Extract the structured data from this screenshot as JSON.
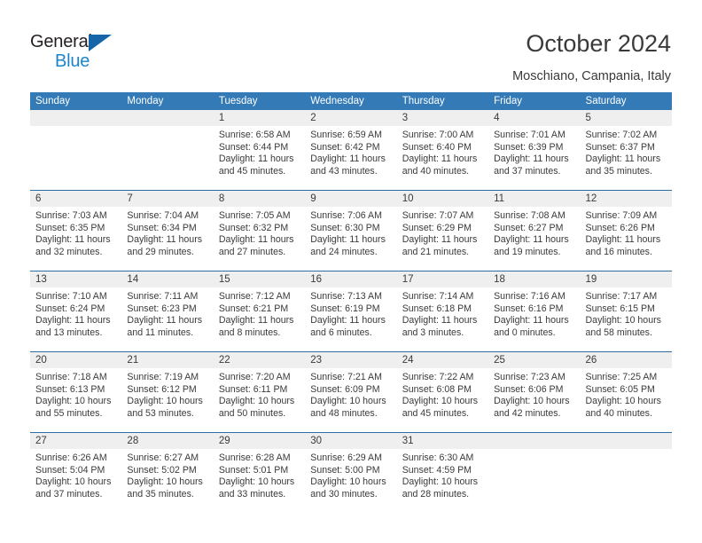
{
  "brand": {
    "name_top": "General",
    "name_bottom": "Blue",
    "triangle_color": "#1565a8",
    "blue_color": "#1b84cd"
  },
  "header": {
    "title": "October 2024",
    "subtitle": "Moschiano, Campania, Italy"
  },
  "theme": {
    "header_blue": "#337ab7",
    "separator_blue": "#2f6ea5",
    "daynum_band": "#efefef",
    "text": "#3a3a3a"
  },
  "calendar": {
    "weekday_headers": [
      "Sunday",
      "Monday",
      "Tuesday",
      "Wednesday",
      "Thursday",
      "Friday",
      "Saturday"
    ],
    "weeks": [
      [
        {
          "day": "",
          "lines": []
        },
        {
          "day": "",
          "lines": []
        },
        {
          "day": "1",
          "lines": [
            "Sunrise: 6:58 AM",
            "Sunset: 6:44 PM",
            "Daylight: 11 hours",
            "and 45 minutes."
          ]
        },
        {
          "day": "2",
          "lines": [
            "Sunrise: 6:59 AM",
            "Sunset: 6:42 PM",
            "Daylight: 11 hours",
            "and 43 minutes."
          ]
        },
        {
          "day": "3",
          "lines": [
            "Sunrise: 7:00 AM",
            "Sunset: 6:40 PM",
            "Daylight: 11 hours",
            "and 40 minutes."
          ]
        },
        {
          "day": "4",
          "lines": [
            "Sunrise: 7:01 AM",
            "Sunset: 6:39 PM",
            "Daylight: 11 hours",
            "and 37 minutes."
          ]
        },
        {
          "day": "5",
          "lines": [
            "Sunrise: 7:02 AM",
            "Sunset: 6:37 PM",
            "Daylight: 11 hours",
            "and 35 minutes."
          ]
        }
      ],
      [
        {
          "day": "6",
          "lines": [
            "Sunrise: 7:03 AM",
            "Sunset: 6:35 PM",
            "Daylight: 11 hours",
            "and 32 minutes."
          ]
        },
        {
          "day": "7",
          "lines": [
            "Sunrise: 7:04 AM",
            "Sunset: 6:34 PM",
            "Daylight: 11 hours",
            "and 29 minutes."
          ]
        },
        {
          "day": "8",
          "lines": [
            "Sunrise: 7:05 AM",
            "Sunset: 6:32 PM",
            "Daylight: 11 hours",
            "and 27 minutes."
          ]
        },
        {
          "day": "9",
          "lines": [
            "Sunrise: 7:06 AM",
            "Sunset: 6:30 PM",
            "Daylight: 11 hours",
            "and 24 minutes."
          ]
        },
        {
          "day": "10",
          "lines": [
            "Sunrise: 7:07 AM",
            "Sunset: 6:29 PM",
            "Daylight: 11 hours",
            "and 21 minutes."
          ]
        },
        {
          "day": "11",
          "lines": [
            "Sunrise: 7:08 AM",
            "Sunset: 6:27 PM",
            "Daylight: 11 hours",
            "and 19 minutes."
          ]
        },
        {
          "day": "12",
          "lines": [
            "Sunrise: 7:09 AM",
            "Sunset: 6:26 PM",
            "Daylight: 11 hours",
            "and 16 minutes."
          ]
        }
      ],
      [
        {
          "day": "13",
          "lines": [
            "Sunrise: 7:10 AM",
            "Sunset: 6:24 PM",
            "Daylight: 11 hours",
            "and 13 minutes."
          ]
        },
        {
          "day": "14",
          "lines": [
            "Sunrise: 7:11 AM",
            "Sunset: 6:23 PM",
            "Daylight: 11 hours",
            "and 11 minutes."
          ]
        },
        {
          "day": "15",
          "lines": [
            "Sunrise: 7:12 AM",
            "Sunset: 6:21 PM",
            "Daylight: 11 hours",
            "and 8 minutes."
          ]
        },
        {
          "day": "16",
          "lines": [
            "Sunrise: 7:13 AM",
            "Sunset: 6:19 PM",
            "Daylight: 11 hours",
            "and 6 minutes."
          ]
        },
        {
          "day": "17",
          "lines": [
            "Sunrise: 7:14 AM",
            "Sunset: 6:18 PM",
            "Daylight: 11 hours",
            "and 3 minutes."
          ]
        },
        {
          "day": "18",
          "lines": [
            "Sunrise: 7:16 AM",
            "Sunset: 6:16 PM",
            "Daylight: 11 hours",
            "and 0 minutes."
          ]
        },
        {
          "day": "19",
          "lines": [
            "Sunrise: 7:17 AM",
            "Sunset: 6:15 PM",
            "Daylight: 10 hours",
            "and 58 minutes."
          ]
        }
      ],
      [
        {
          "day": "20",
          "lines": [
            "Sunrise: 7:18 AM",
            "Sunset: 6:13 PM",
            "Daylight: 10 hours",
            "and 55 minutes."
          ]
        },
        {
          "day": "21",
          "lines": [
            "Sunrise: 7:19 AM",
            "Sunset: 6:12 PM",
            "Daylight: 10 hours",
            "and 53 minutes."
          ]
        },
        {
          "day": "22",
          "lines": [
            "Sunrise: 7:20 AM",
            "Sunset: 6:11 PM",
            "Daylight: 10 hours",
            "and 50 minutes."
          ]
        },
        {
          "day": "23",
          "lines": [
            "Sunrise: 7:21 AM",
            "Sunset: 6:09 PM",
            "Daylight: 10 hours",
            "and 48 minutes."
          ]
        },
        {
          "day": "24",
          "lines": [
            "Sunrise: 7:22 AM",
            "Sunset: 6:08 PM",
            "Daylight: 10 hours",
            "and 45 minutes."
          ]
        },
        {
          "day": "25",
          "lines": [
            "Sunrise: 7:23 AM",
            "Sunset: 6:06 PM",
            "Daylight: 10 hours",
            "and 42 minutes."
          ]
        },
        {
          "day": "26",
          "lines": [
            "Sunrise: 7:25 AM",
            "Sunset: 6:05 PM",
            "Daylight: 10 hours",
            "and 40 minutes."
          ]
        }
      ],
      [
        {
          "day": "27",
          "lines": [
            "Sunrise: 6:26 AM",
            "Sunset: 5:04 PM",
            "Daylight: 10 hours",
            "and 37 minutes."
          ]
        },
        {
          "day": "28",
          "lines": [
            "Sunrise: 6:27 AM",
            "Sunset: 5:02 PM",
            "Daylight: 10 hours",
            "and 35 minutes."
          ]
        },
        {
          "day": "29",
          "lines": [
            "Sunrise: 6:28 AM",
            "Sunset: 5:01 PM",
            "Daylight: 10 hours",
            "and 33 minutes."
          ]
        },
        {
          "day": "30",
          "lines": [
            "Sunrise: 6:29 AM",
            "Sunset: 5:00 PM",
            "Daylight: 10 hours",
            "and 30 minutes."
          ]
        },
        {
          "day": "31",
          "lines": [
            "Sunrise: 6:30 AM",
            "Sunset: 4:59 PM",
            "Daylight: 10 hours",
            "and 28 minutes."
          ]
        },
        {
          "day": "",
          "lines": []
        },
        {
          "day": "",
          "lines": []
        }
      ]
    ]
  }
}
